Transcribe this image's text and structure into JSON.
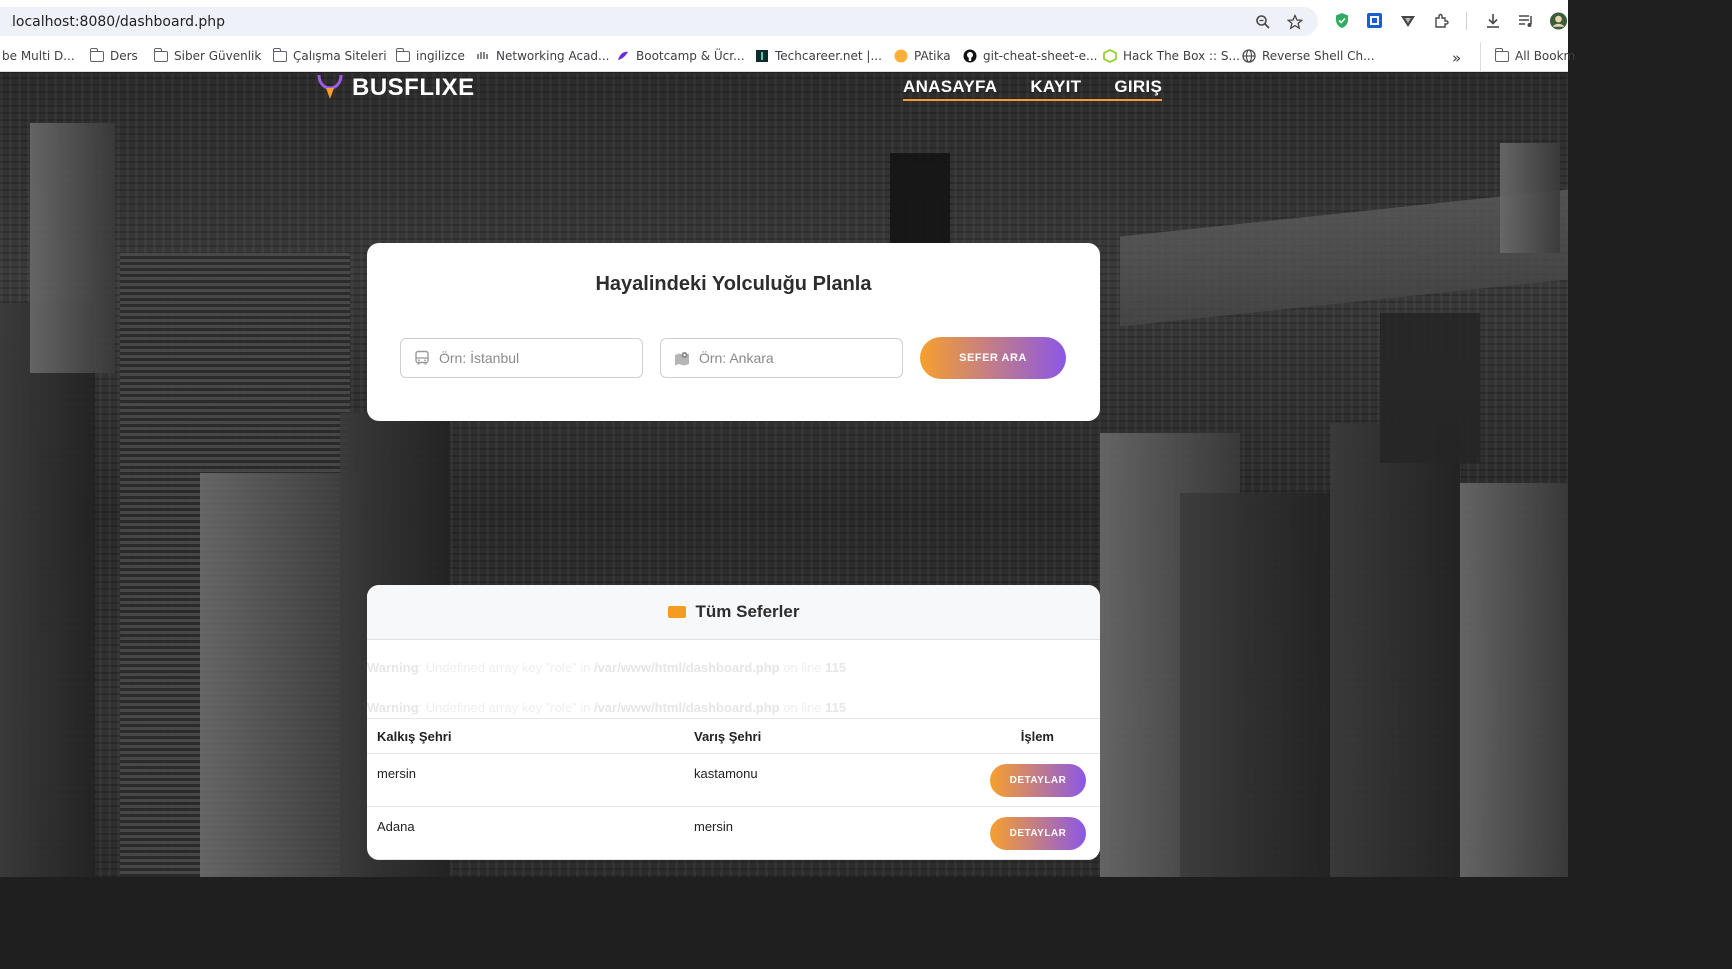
{
  "browser": {
    "url": "localhost:8080/dashboard.php",
    "bookmarks": [
      {
        "label": "be Multi D...",
        "icon": "none"
      },
      {
        "label": "Ders",
        "icon": "folder-icon"
      },
      {
        "label": "Siber Güvenlik",
        "icon": "folder-icon"
      },
      {
        "label": "Çalışma Siteleri",
        "icon": "folder-icon"
      },
      {
        "label": "ingilizce",
        "icon": "folder-icon"
      },
      {
        "label": "Networking Acad...",
        "icon": "cisco-icon"
      },
      {
        "label": "Bootcamp & Ücr...",
        "icon": "bootcamp-icon"
      },
      {
        "label": "Techcareer.net |...",
        "icon": "techcareer-icon"
      },
      {
        "label": "PAtika",
        "icon": "patika-icon"
      },
      {
        "label": "git-cheat-sheet-e...",
        "icon": "github-icon"
      },
      {
        "label": "Hack The Box :: S...",
        "icon": "htb-icon"
      },
      {
        "label": "Reverse Shell Ch...",
        "icon": "globe-icon"
      }
    ],
    "more_label": "»",
    "all_bookmarks": "All Bookm"
  },
  "header": {
    "brand": "BUSFLIXE",
    "nav": [
      "ANASAYFA",
      "KAYIT",
      "GIRIŞ"
    ]
  },
  "search": {
    "title": "Hayalindeki Yolculuğu Planla",
    "from_placeholder": "Örn: İstanbul",
    "to_placeholder": "Örn: Ankara",
    "button": "SEFER ARA"
  },
  "trips": {
    "title": "Tüm Seferler",
    "warnings": [
      {
        "label": "Warning",
        "text": ": Undefined array key \"role\" in ",
        "file": "/var/www/html/dashboard.php",
        "suffix": " on line ",
        "line": "115"
      },
      {
        "label": "Warning",
        "text": ": Undefined array key \"role\" in ",
        "file": "/var/www/html/dashboard.php",
        "suffix": " on line ",
        "line": "115"
      }
    ],
    "columns": [
      "Kalkış Şehri",
      "Varış Şehri",
      "İşlem"
    ],
    "rows": [
      {
        "from": "mersin",
        "to": "kastamonu",
        "action": "DETAYLAR"
      },
      {
        "from": "Adana",
        "to": "mersin",
        "action": "DETAYLAR"
      }
    ]
  },
  "colors": {
    "accent_orange": "#f6a02e",
    "accent_purple": "#8b57e6"
  }
}
